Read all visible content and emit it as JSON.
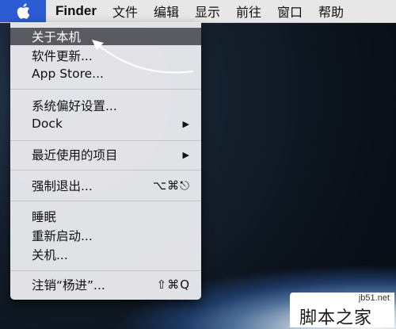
{
  "menubar": {
    "apple_icon": "apple-logo-icon",
    "items": [
      "Finder",
      "文件",
      "编辑",
      "显示",
      "前往",
      "窗口",
      "帮助"
    ]
  },
  "apple_menu": {
    "items": [
      {
        "label": "关于本机",
        "shortcut": "",
        "highlighted": true
      },
      {
        "label": "软件更新...",
        "shortcut": ""
      },
      {
        "label": "App Store...",
        "shortcut": ""
      },
      {
        "label": "系统偏好设置...",
        "shortcut": ""
      },
      {
        "label": "Dock",
        "shortcut": "▶"
      },
      {
        "label": "最近使用的项目",
        "shortcut": "▶"
      },
      {
        "label": "强制退出...",
        "shortcut": "⌥⌘⎋"
      },
      {
        "label": "睡眠",
        "shortcut": ""
      },
      {
        "label": "重新启动...",
        "shortcut": ""
      },
      {
        "label": "关机...",
        "shortcut": ""
      },
      {
        "label": "注销“杨进”...",
        "shortcut": "⇧⌘Q"
      }
    ]
  },
  "watermark": {
    "site": "jb51.net",
    "text": "脚本之家"
  },
  "colors": {
    "highlight": "#5a5a62",
    "apple_button": "#2d5bd4",
    "menubar": "#e7e7e7"
  }
}
